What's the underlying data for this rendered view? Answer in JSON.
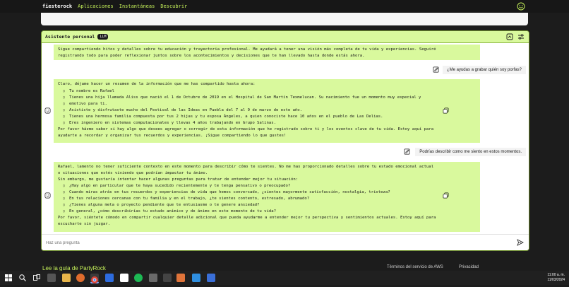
{
  "nav": {
    "brand": "fiesterock",
    "links": [
      "Aplicaciones",
      "Instantáneas",
      "Descubrir"
    ]
  },
  "card": {
    "title": "Asistente personal",
    "badge": "LLM"
  },
  "messages": {
    "m1": {
      "lines": [
        "Sigue compartiendo hitos y detalles sobre tu educación y trayectoria profesional. Me ayudará a tener una visión más completa de tu vida y experiencias. Seguiré",
        "registrando todo para poder reflexionar juntos sobre los acontecimientos y decisiones que te han llevado hasta donde estás ahora."
      ]
    },
    "u1": "¿Me ayudas a grabar quién soy porfas?",
    "m2": {
      "intro": "Claro, déjame hacer un resumen de la información que me has compartido hasta ahora:",
      "items": [
        "Tu nombre es Rafael",
        "Tienes una hija llamada Aliss que nació el 1 de Octubre de 2019 en el Hospital de San Martín Texmelucan. Su nacimiento fue un momento muy especial y",
        "emotivo para ti.",
        "Asististe y disfrutaste mucho del Festival de las Ideas en Puebla del 7 al 9 de marzo de este año.",
        "Tienes una hermosa familia compuesta por tus 2 hijas y tu esposa Ángeles, a quien conociste hace 10 años en el pueblo de Las Delias.",
        "Eres ingeniero en sistemas computacionales y llevas 4 años trabajando en Grupo Salinas."
      ],
      "outro1": "Por favor házme saber si hay algo que desees agregar o corregir de esta información que he registrado sobre ti y los eventos clave de tu vida. Estoy aquí para",
      "outro2": "ayudarte a recordar y organizar tus recuerdos y experiencias. ¡Sigue compartiendo lo que gustes!"
    },
    "u2": "Podrías describir como me siento en estos momentos.",
    "m3": {
      "p1a": "Rafael, lamento no tener suficiente contexto en este momento para describir cómo te sientes. No me has proporcionado detalles sobre tu estado emocional actual",
      "p1b": "o situaciones que estés viviendo que podrían impactar tu ánimo.",
      "p2": "Sin embargo, me gustaría intentar hacer algunas preguntas para tratar de entender mejor tu situación:",
      "items": [
        "¿Hay algo en particular que te haya sucedido recientemente y te tenga pensativo o preocupado?",
        "Cuando miras atrás en tus recuerdos y experiencias de vida que hemos conversado, ¿sientes mayormente satisfacción, nostalgia, tristeza?",
        "En tus relaciones cercanas con tu familia y en el trabajo, ¿te sientes contento, estresado, abrumado?",
        "¿Tienes alguna meta o proyecto pendiente que te entusiasme o te genere ansiedad?",
        "En general, ¿cómo describirías tu estado anímico y de ánimo en este momento de tu vida?"
      ],
      "outro1": "Por favor, siéntete cómodo en compartir cualquier detalle adicional que pueda ayudarme a entender mejor tu perspectiva y sentimientos actuales. Estoy aquí para",
      "outro2": "escucharte sin juzgar."
    }
  },
  "input": {
    "placeholder": "Haz una pregunta"
  },
  "footer": {
    "guide": "Lee la guía de PartyRock",
    "terms": "Términos del servicio de AWS",
    "privacy": "Privacidad"
  },
  "taskbar": {
    "time": "11:00 a. m.",
    "date": "11/03/2024"
  },
  "colors": {
    "accent": "#d9f99d",
    "nav_link": "#c6f25a",
    "dark": "#1c1c1c"
  },
  "icons": [
    "smiley-icon",
    "app-icon",
    "settings-icon",
    "ai-avatar-icon",
    "copy-icon",
    "edit-icon",
    "send-icon"
  ]
}
